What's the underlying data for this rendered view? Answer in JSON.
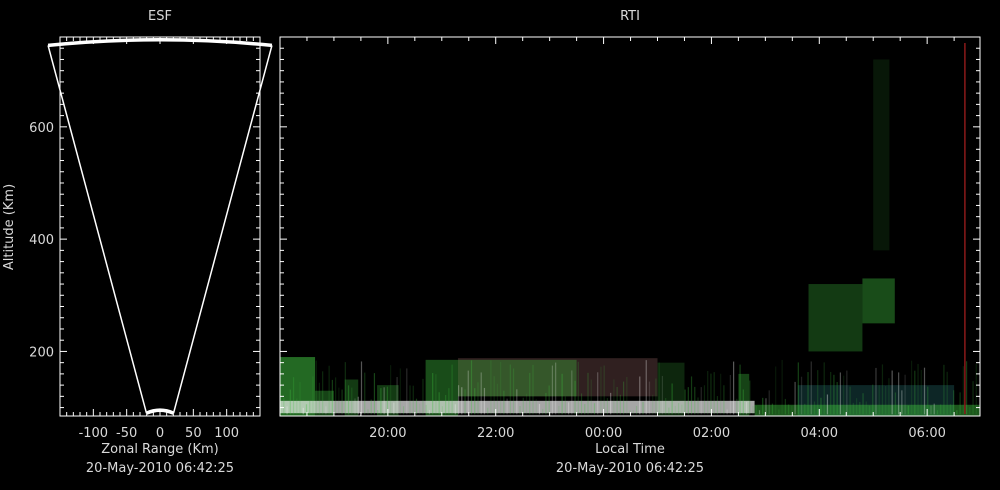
{
  "colors": {
    "background": "#000000",
    "axis": "#ffffff",
    "text": "#d9d9d9",
    "cone": "#ffffff",
    "marker": "#8b1a1a",
    "echo_green": "#3fbf3f",
    "echo_white": "#ffffff",
    "echo_cyan": "#3fbfbf",
    "echo_pink": "#bf7f7f"
  },
  "chart_data": [
    {
      "type": "scatter",
      "name": "esf-panel",
      "title": "ESF",
      "xlabel": "Zonal Range (Km)",
      "ylabel": "Altitude (Km)",
      "xlim": [
        -150,
        150
      ],
      "ylim": [
        85,
        760
      ],
      "x_ticks": [
        -100,
        -50,
        0,
        50,
        100
      ],
      "x_tick_labels": [
        "-100",
        "-50",
        "0",
        "50",
        "100"
      ],
      "y_ticks": [
        200,
        400,
        600
      ],
      "y_tick_labels": [
        "200",
        "400",
        "600"
      ],
      "timestamp": "20-May-2010 06:42:25",
      "cone": {
        "apex_altitude": 90,
        "top_altitude": 745,
        "half_angle_deg": 12.7,
        "top_arc_sag": 10
      }
    },
    {
      "type": "heatmap",
      "name": "rti-panel",
      "title": "RTI",
      "xlabel": "Local Time",
      "ylabel": "",
      "x_tick_labels": [
        "20:00",
        "22:00",
        "00:00",
        "02:00",
        "04:00",
        "06:00"
      ],
      "x_ticks_hours": [
        20,
        22,
        24,
        26,
        28,
        30
      ],
      "xlim_hours": [
        18.0,
        30.98
      ],
      "ylim": [
        85,
        760
      ],
      "y_ticks": [
        200,
        400,
        600
      ],
      "timestamp": "20-May-2010 06:42:25",
      "current_time_marker_hours": 30.7,
      "echo_regions": [
        {
          "start": 18.0,
          "end": 18.65,
          "alt_low": 85,
          "alt_high": 190,
          "color": "#3fbf3f",
          "intensity": 0.55
        },
        {
          "start": 18.65,
          "end": 19.0,
          "alt_low": 85,
          "alt_high": 130,
          "color": "#3fbf3f",
          "intensity": 0.35
        },
        {
          "start": 19.2,
          "end": 19.45,
          "alt_low": 85,
          "alt_high": 150,
          "color": "#3fbf3f",
          "intensity": 0.3
        },
        {
          "start": 19.8,
          "end": 20.2,
          "alt_low": 85,
          "alt_high": 140,
          "color": "#3fbf3f",
          "intensity": 0.3
        },
        {
          "start": 20.7,
          "end": 21.3,
          "alt_low": 85,
          "alt_high": 185,
          "color": "#3fbf3f",
          "intensity": 0.4
        },
        {
          "start": 21.3,
          "end": 25.0,
          "alt_low": 120,
          "alt_high": 188,
          "color": "#bf7f7f",
          "intensity": 0.25
        },
        {
          "start": 21.3,
          "end": 23.5,
          "alt_low": 120,
          "alt_high": 185,
          "color": "#3fbf3f",
          "intensity": 0.35
        },
        {
          "start": 25.0,
          "end": 25.5,
          "alt_low": 85,
          "alt_high": 180,
          "color": "#3fbf3f",
          "intensity": 0.2
        },
        {
          "start": 26.5,
          "end": 26.7,
          "alt_low": 85,
          "alt_high": 160,
          "color": "#3fbf3f",
          "intensity": 0.35
        },
        {
          "start": 27.6,
          "end": 30.5,
          "alt_low": 85,
          "alt_high": 140,
          "color": "#3fbfbf",
          "intensity": 0.2
        },
        {
          "start": 18.0,
          "end": 26.8,
          "alt_low": 90,
          "alt_high": 112,
          "color": "#ffffff",
          "intensity": 0.65
        },
        {
          "start": 26.8,
          "end": 30.98,
          "alt_low": 85,
          "alt_high": 105,
          "color": "#3fbf3f",
          "intensity": 0.45
        },
        {
          "start": 27.8,
          "end": 28.8,
          "alt_low": 200,
          "alt_high": 320,
          "color": "#3fbf3f",
          "intensity": 0.3
        },
        {
          "start": 28.8,
          "end": 29.4,
          "alt_low": 250,
          "alt_high": 330,
          "color": "#3fbf3f",
          "intensity": 0.4
        },
        {
          "start": 29.0,
          "end": 29.3,
          "alt_low": 380,
          "alt_high": 720,
          "color": "#3fbf3f",
          "intensity": 0.12
        }
      ]
    }
  ]
}
